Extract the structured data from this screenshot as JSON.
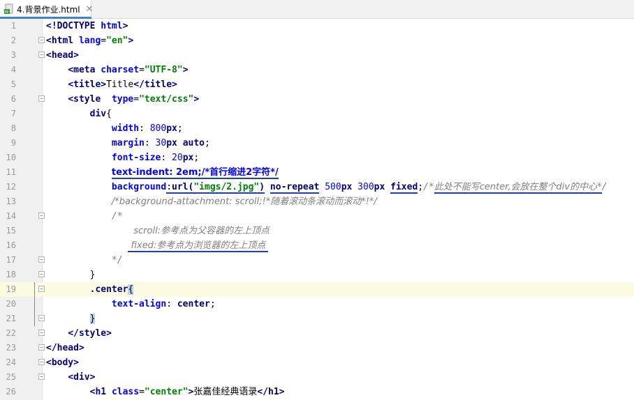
{
  "tab": {
    "filename": "4.背景作业.html",
    "close_glyph": "✕",
    "icon": "html-file-icon"
  },
  "colors": {
    "tag": "#000080",
    "attribute": "#0000ff",
    "string": "#008000",
    "comment": "#808080",
    "current_line": "#fcfae0",
    "annotation_underline": "#1f3fa6"
  },
  "editor": {
    "current_line": 19,
    "lines": [
      {
        "n": "1",
        "segs": [
          [
            "tag",
            "<!DOCTYPE "
          ],
          [
            "attr",
            "html"
          ],
          [
            "tag",
            ">"
          ]
        ]
      },
      {
        "n": "2",
        "segs": [
          [
            "tag",
            "<html "
          ],
          [
            "attr",
            "lang"
          ],
          [
            "plain",
            "="
          ],
          [
            "str",
            "\"en\""
          ],
          [
            "tag",
            ">"
          ]
        ]
      },
      {
        "n": "3",
        "segs": [
          [
            "tag",
            "<head>"
          ]
        ]
      },
      {
        "n": "4",
        "segs": [
          [
            "plain",
            "    "
          ],
          [
            "tag",
            "<meta "
          ],
          [
            "attr",
            "charset"
          ],
          [
            "plain",
            "="
          ],
          [
            "str",
            "\"UTF-8\""
          ],
          [
            "tag",
            ">"
          ]
        ]
      },
      {
        "n": "5",
        "segs": [
          [
            "plain",
            "    "
          ],
          [
            "tag",
            "<title>"
          ],
          [
            "plain",
            "Title"
          ],
          [
            "tag",
            "</title>"
          ]
        ]
      },
      {
        "n": "6",
        "segs": [
          [
            "plain",
            "    "
          ],
          [
            "tag",
            "<style  "
          ],
          [
            "attr",
            "type"
          ],
          [
            "plain",
            "="
          ],
          [
            "str",
            "\"text/css\""
          ],
          [
            "tag",
            ">"
          ]
        ]
      },
      {
        "n": "7",
        "segs": [
          [
            "plain",
            "        "
          ],
          [
            "sel",
            "div"
          ],
          [
            "plain",
            "{"
          ]
        ]
      },
      {
        "n": "8",
        "segs": [
          [
            "plain",
            "            "
          ],
          [
            "prop",
            "width"
          ],
          [
            "plain",
            ": "
          ],
          [
            "num",
            "800"
          ],
          [
            "kw",
            "px"
          ],
          [
            "plain",
            ";"
          ]
        ]
      },
      {
        "n": "9",
        "segs": [
          [
            "plain",
            "            "
          ],
          [
            "prop",
            "margin"
          ],
          [
            "plain",
            ": "
          ],
          [
            "num",
            "30"
          ],
          [
            "kw",
            "px"
          ],
          [
            "plain",
            " "
          ],
          [
            "kw",
            "auto"
          ],
          [
            "plain",
            ";"
          ]
        ]
      },
      {
        "n": "10",
        "segs": [
          [
            "plain",
            "            "
          ],
          [
            "prop",
            "font-size"
          ],
          [
            "plain",
            ": "
          ],
          [
            "num",
            "20"
          ],
          [
            "kw",
            "px"
          ],
          [
            "plain",
            ";"
          ]
        ]
      },
      {
        "n": "11",
        "segs": [
          [
            "plain",
            "            "
          ],
          [
            "prop|ul",
            "text-indent: 2em;/*首行缩进2字符*/"
          ]
        ]
      },
      {
        "n": "12",
        "segs": [
          [
            "plain",
            "            "
          ],
          [
            "prop",
            "background"
          ],
          [
            "plain|ul",
            ":"
          ],
          [
            "kw|ul",
            "url("
          ],
          [
            "str|ul",
            "\"imgs/2.jpg\""
          ],
          [
            "kw|ul",
            ")"
          ],
          [
            "plain",
            " "
          ],
          [
            "kw|ul",
            "no-repeat"
          ],
          [
            "plain",
            " "
          ],
          [
            "num",
            "500"
          ],
          [
            "kw",
            "px"
          ],
          [
            "plain",
            " "
          ],
          [
            "num",
            "300"
          ],
          [
            "kw",
            "px"
          ],
          [
            "plain",
            " "
          ],
          [
            "kw|ul",
            "fixed"
          ],
          [
            "plain",
            ";"
          ],
          [
            "com",
            "/*"
          ],
          [
            "com|ul",
            "此处不能写center,会放在整个div的中心*"
          ],
          [
            "com",
            "/"
          ]
        ]
      },
      {
        "n": "13",
        "segs": [
          [
            "plain",
            "            "
          ],
          [
            "com",
            "/*background-attachment: scroll;!*随着滚动条滚动而滚动*!*/"
          ]
        ]
      },
      {
        "n": "14",
        "segs": [
          [
            "plain",
            "            "
          ],
          [
            "com",
            "/*"
          ]
        ]
      },
      {
        "n": "15",
        "segs": [
          [
            "plain",
            "                "
          ],
          [
            "com",
            "scroll:参考点为父容器的左上顶点"
          ]
        ]
      },
      {
        "n": "16",
        "segs": [
          [
            "plain",
            "               "
          ],
          [
            "com|ul",
            " fixed:参考点为浏览器的左上顶点 "
          ]
        ]
      },
      {
        "n": "17",
        "segs": [
          [
            "plain",
            "            "
          ],
          [
            "com",
            "*/"
          ]
        ]
      },
      {
        "n": "18",
        "segs": [
          [
            "plain",
            "        "
          ],
          [
            "plain",
            "}"
          ]
        ]
      },
      {
        "n": "19",
        "segs": [
          [
            "plain",
            "        "
          ],
          [
            "sel",
            ".center"
          ],
          [
            "hl",
            "{"
          ]
        ]
      },
      {
        "n": "20",
        "segs": [
          [
            "plain",
            "            "
          ],
          [
            "prop",
            "text-align"
          ],
          [
            "plain",
            ": "
          ],
          [
            "kw",
            "center"
          ],
          [
            "plain",
            ";"
          ]
        ]
      },
      {
        "n": "21",
        "segs": [
          [
            "plain",
            "        "
          ],
          [
            "hl",
            "}"
          ]
        ]
      },
      {
        "n": "22",
        "segs": [
          [
            "plain",
            "    "
          ],
          [
            "tag",
            "</style>"
          ]
        ]
      },
      {
        "n": "23",
        "segs": [
          [
            "tag",
            "</head>"
          ]
        ]
      },
      {
        "n": "24",
        "segs": [
          [
            "tag",
            "<body>"
          ]
        ]
      },
      {
        "n": "25",
        "segs": [
          [
            "plain",
            "    "
          ],
          [
            "tag",
            "<div>"
          ]
        ]
      },
      {
        "n": "26",
        "segs": [
          [
            "plain",
            "        "
          ],
          [
            "tag",
            "<h1 "
          ],
          [
            "attr",
            "class"
          ],
          [
            "plain",
            "="
          ],
          [
            "str",
            "\"center\""
          ],
          [
            "tag",
            ">"
          ],
          [
            "plain",
            "张嘉佳经典语录"
          ],
          [
            "tag",
            "</h1>"
          ]
        ]
      }
    ],
    "fold_markers": {
      "2": "−",
      "3": "−",
      "6": "−",
      "14": "−",
      "17": "−",
      "18": "−",
      "19": "−",
      "21": "−",
      "22": "−",
      "23": "−",
      "24": "−",
      "25": "−"
    }
  }
}
